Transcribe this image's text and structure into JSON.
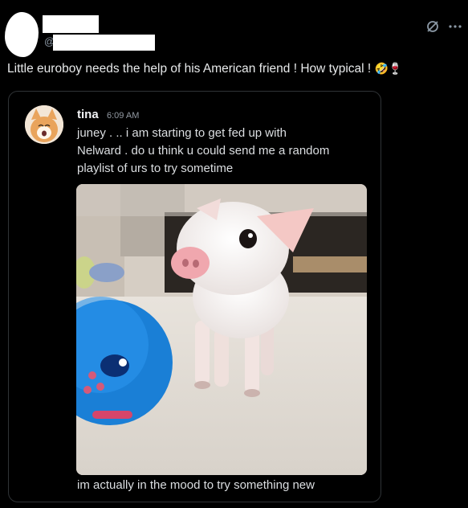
{
  "post": {
    "handle_prefix": "@",
    "text": "Little euroboy needs the help of his American friend ! How typical ! ",
    "emojis": "🤣🍷"
  },
  "icons": {
    "grok": "grok-icon",
    "more": "more-icon"
  },
  "embed": {
    "author": "tina",
    "time": "6:09 AM",
    "lines": [
      "juney . .. i am starting to get fed up with",
      "Nelward . do u think u could send me a random",
      "playlist of urs to try sometime"
    ],
    "footer": "im actually in the mood to try something new"
  }
}
